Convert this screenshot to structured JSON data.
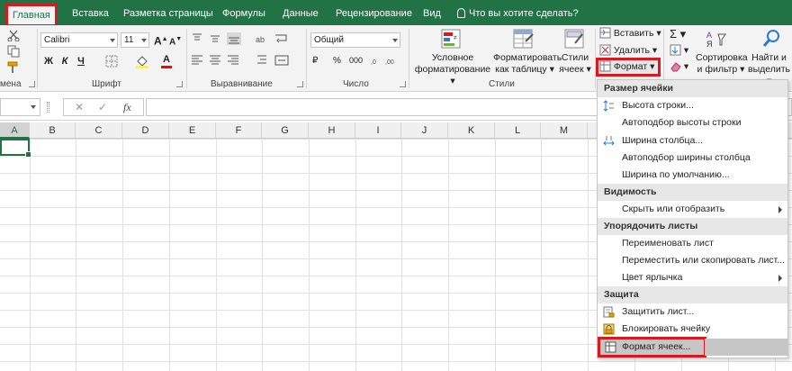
{
  "tabs": [
    {
      "label": "Главная",
      "active": true
    },
    {
      "label": "Вставка"
    },
    {
      "label": "Разметка страницы"
    },
    {
      "label": "Формулы"
    },
    {
      "label": "Данные"
    },
    {
      "label": "Рецензирование"
    },
    {
      "label": "Вид"
    }
  ],
  "tell_me": "Что вы хотите сделать?",
  "clipboard": {
    "label": "мена"
  },
  "font": {
    "name": "Calibri",
    "size": "11",
    "bold": "Ж",
    "italic": "К",
    "underline": "Ч",
    "label": "Шрифт",
    "grow": "A",
    "shrink": "A",
    "font_color_letter": "A"
  },
  "alignment": {
    "label": "Выравнивание"
  },
  "number": {
    "format": "Общий",
    "label": "Число",
    "currency": "₽",
    "percent": "%",
    "thousands": "000"
  },
  "styles": {
    "label": "Стили",
    "conditional": [
      "Условное",
      "форматирование"
    ],
    "format_table": [
      "Форматировать",
      "как таблицу"
    ],
    "cell_styles": [
      "Стили",
      "ячеек"
    ]
  },
  "cells": {
    "insert": "Вставить",
    "delete": "Удалить",
    "format": "Формат"
  },
  "editing": {
    "sort": [
      "Сортировка",
      "и фильтр"
    ],
    "find": [
      "Найти и",
      "выделить"
    ]
  },
  "formula_bar": {
    "fx": "fx"
  },
  "columns": [
    "A",
    "B",
    "C",
    "D",
    "E",
    "F",
    "G",
    "H",
    "I",
    "J",
    "K",
    "L",
    "M"
  ],
  "menu": {
    "sections": [
      {
        "title": "Размер ячейки",
        "items": [
          {
            "label": "Высота строки...",
            "icon": "row-height-icon"
          },
          {
            "label": "Автоподбор высоты строки"
          },
          {
            "label": "Ширина столбца...",
            "icon": "column-width-icon"
          },
          {
            "label": "Автоподбор ширины столбца"
          },
          {
            "label": "Ширина по умолчанию..."
          }
        ]
      },
      {
        "title": "Видимость",
        "items": [
          {
            "label": "Скрыть или отобразить",
            "submenu": true
          }
        ]
      },
      {
        "title": "Упорядочить листы",
        "items": [
          {
            "label": "Переименовать лист"
          },
          {
            "label": "Переместить или скопировать лист..."
          },
          {
            "label": "Цвет ярлычка",
            "submenu": true
          }
        ]
      },
      {
        "title": "Защита",
        "items": [
          {
            "label": "Защитить лист...",
            "icon": "protect-sheet-icon"
          },
          {
            "label": "Блокировать ячейку",
            "icon": "lock-icon"
          },
          {
            "label": "Формат ячеек...",
            "icon": "format-cells-icon",
            "highlighted": true
          }
        ]
      }
    ]
  },
  "colors": {
    "excel_green": "#217346",
    "highlight_red": "#d71920",
    "fill_yellow": "#ffff00",
    "font_red": "#ff0000"
  }
}
